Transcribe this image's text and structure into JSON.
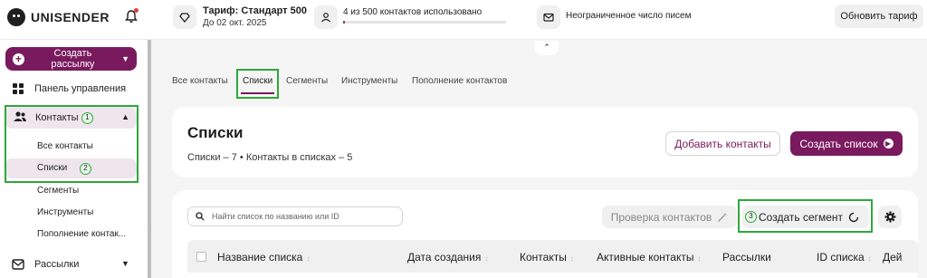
{
  "app": {
    "logo_text": "UNISENDER"
  },
  "header": {
    "tariff_title": "Тариф: Стандарт 500",
    "tariff_until": "До 02 окт. 2025",
    "contacts_usage": "4 из 500 контактов использовано",
    "contacts_used_fraction": 0.008,
    "mail_limit": "Неограниченное число писем",
    "upgrade_label": "Обновить тариф"
  },
  "sidebar": {
    "create_mailing_label": "Создать рассылку",
    "dashboard_label": "Панель управления",
    "contacts_label": "Контакты",
    "contacts_sub": [
      "Все контакты",
      "Списки",
      "Сегменты",
      "Инструменты",
      "Пополнение контак..."
    ],
    "mailings_label": "Рассылки",
    "badges": [
      "1",
      "2",
      "3"
    ]
  },
  "tabs": [
    "Все контакты",
    "Списки",
    "Сегменты",
    "Инструменты",
    "Пополнение контактов"
  ],
  "page": {
    "title": "Списки",
    "summary": "Списки – 7 • Контакты в списках – 5",
    "add_contacts_label": "Добавить контакты",
    "create_list_label": "Создать список"
  },
  "toolbar": {
    "search_placeholder": "Найти список по названию или ID",
    "check_contacts_label": "Проверка контактов",
    "create_segment_label": "Создать сегмент"
  },
  "table": {
    "columns": [
      "Название списка",
      "Дата создания",
      "Контакты",
      "Активные контакты",
      "Рассылки",
      "ID списка",
      "Дей"
    ]
  },
  "colors": {
    "accent": "#7a1a5e",
    "highlight": "#2fa83a"
  }
}
